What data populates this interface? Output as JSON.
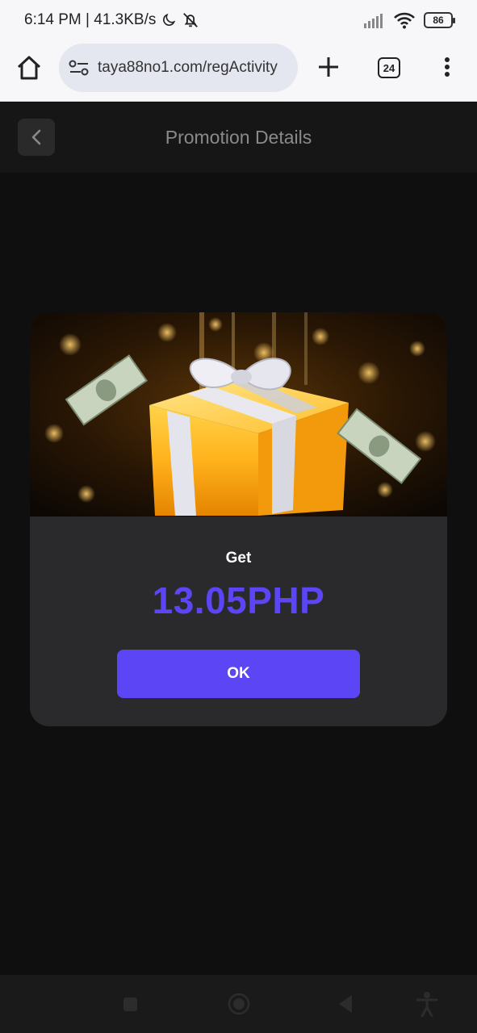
{
  "status": {
    "time_speed": "6:14 PM | 41.3KB/s",
    "battery": "86"
  },
  "browser": {
    "url": "taya88no1.com/regActivity",
    "tab_count": "24"
  },
  "header": {
    "title": "Promotion Details"
  },
  "promo": {
    "label": "Get",
    "amount": "13.05PHP",
    "ok_label": "OK"
  },
  "colors": {
    "accent": "#5b45f5",
    "card_bg": "#2a2a2c",
    "page_bg": "#0f0f0f"
  },
  "icons": [
    "home-icon",
    "site-settings-icon",
    "plus-icon",
    "tabs-icon",
    "menu-icon",
    "back-chevron-icon",
    "moon-icon",
    "bell-off-icon",
    "signal-icon",
    "wifi-icon",
    "battery-icon"
  ]
}
